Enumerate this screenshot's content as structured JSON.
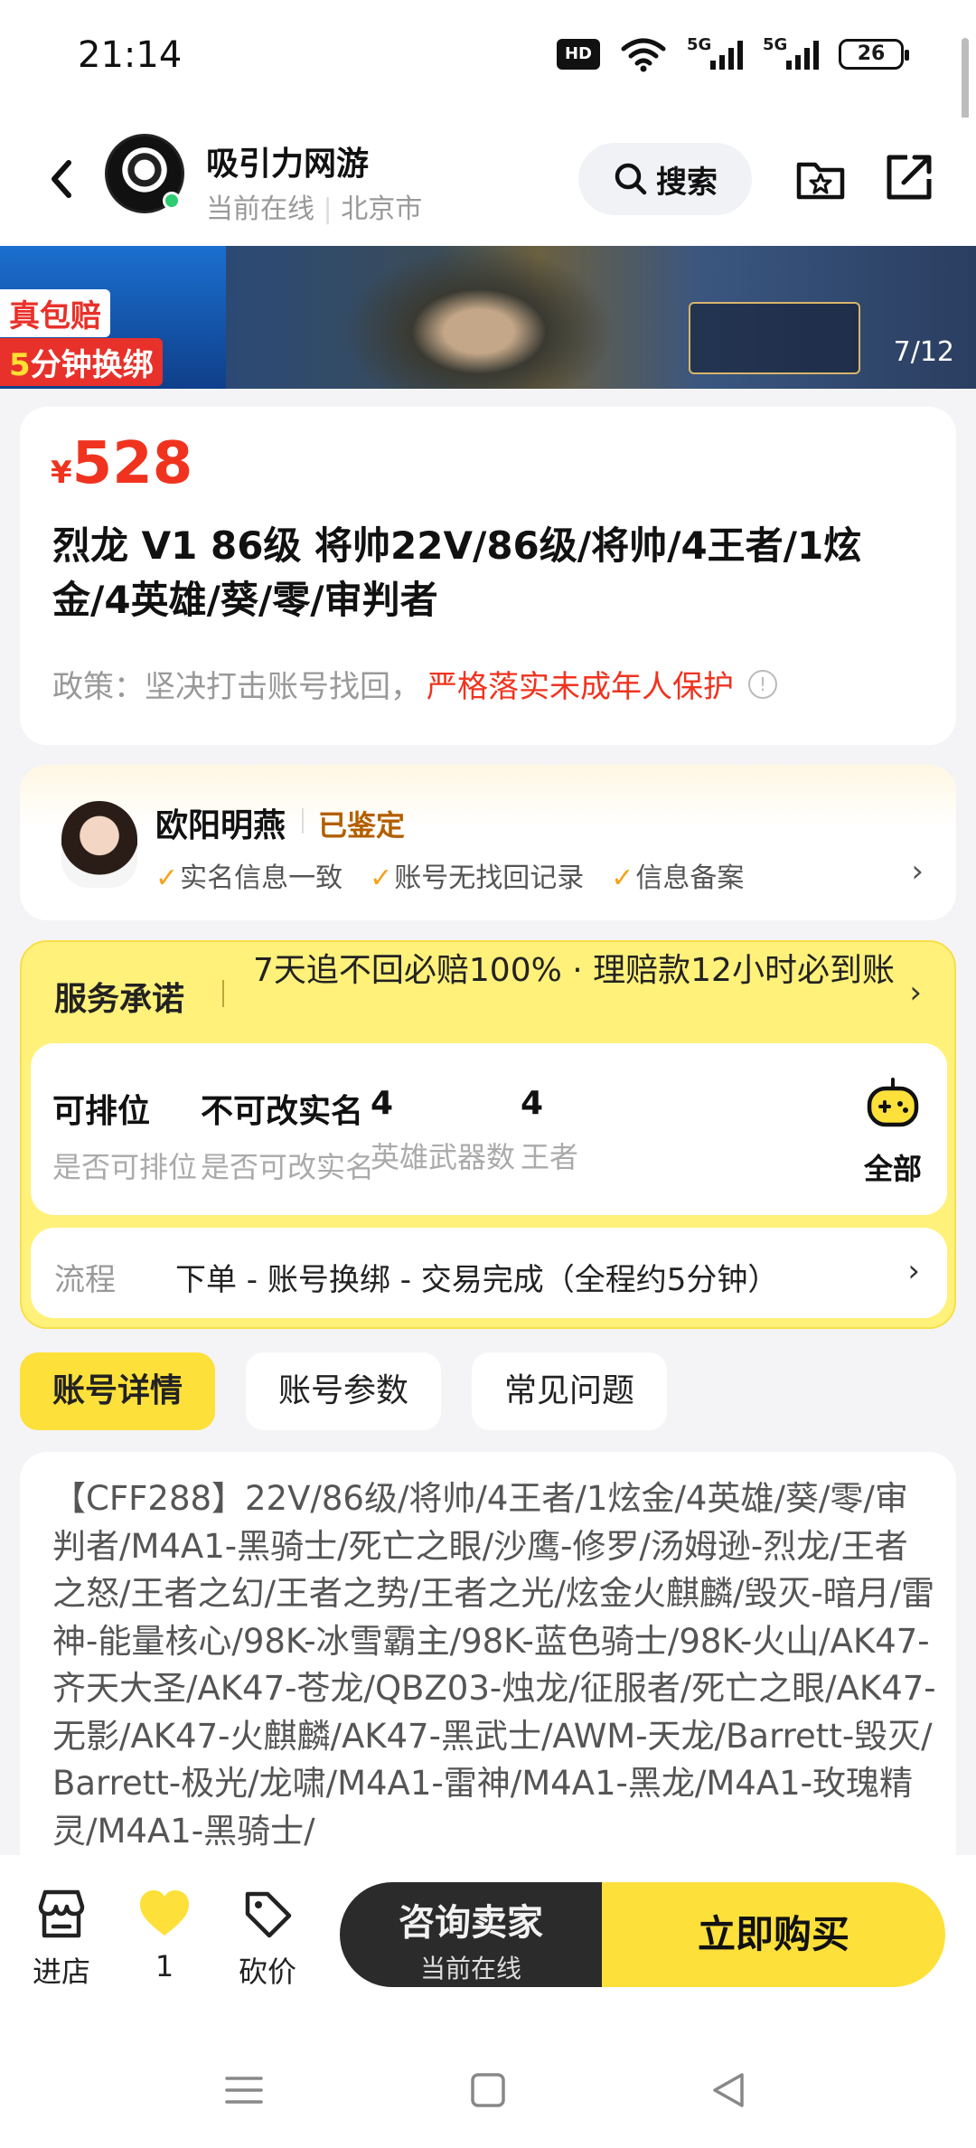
{
  "status_bar": {
    "time": "21:14",
    "hd": "HD",
    "signal1": "5G",
    "signal2": "5G",
    "battery": "26"
  },
  "header": {
    "shop_name": "吸引力网游",
    "shop_status": "当前在线",
    "shop_city": "北京市",
    "search_label": "搜索"
  },
  "banner": {
    "tag_line1": "真包赔",
    "tag_line2_prefix": "5",
    "tag_line2_rest": "分钟换绑",
    "counter": "7/12"
  },
  "product": {
    "currency": "¥",
    "price": "528",
    "title": "烈龙 V1 86级 将帅22V/86级/将帅/4王者/1炫金/4英雄/葵/零/审判者",
    "policy_prefix": "政策：坚决打击账号找回，",
    "policy_highlight": "严格落实未成年人保护",
    "policy_icon": "info-icon"
  },
  "appraiser": {
    "name": "欧阳明燕",
    "status": "已鉴定",
    "checks": [
      "实名信息一致",
      "账号无找回记录",
      "信息备案"
    ]
  },
  "service": {
    "label": "服务承诺",
    "text": "7天追不回必赔100% · 理赔款12小时必到账",
    "attributes": [
      {
        "value": "可排位",
        "key": "是否可排位"
      },
      {
        "value": "不可改实名",
        "key": "是否可改实名"
      },
      {
        "value": "4",
        "key": "英雄武器数"
      },
      {
        "value": "4",
        "key": "王者"
      }
    ],
    "all_label": "全部",
    "flow_label": "流程",
    "flow_text": "下单 - 账号换绑 - 交易完成（全程约5分钟）"
  },
  "tabs": [
    "账号详情",
    "账号参数",
    "常见问题"
  ],
  "details": {
    "text": "【CFF288】22V/86级/将帅/4王者/1炫金/4英雄/葵/零/审判者/M4A1-黑骑士/死亡之眼/沙鹰-修罗/汤姆逊-烈龙/王者之怒/王者之幻/王者之势/王者之光/炫金火麒麟/毁灭-暗月/雷神-能量核心/98K-冰雪霸主/98K-蓝色骑士/98K-火山/AK47-齐天大圣/AK47-苍龙/QBZ03-烛龙/征服者/死亡之眼/AK47-无影/AK47-火麒麟/AK47-黑武士/AWM-天龙/Barrett-毁灭/Barrett-极光/龙啸/M4A1-雷神/M4A1-黑龙/M4A1-玫瑰精灵/M4A1-黑骑士/"
  },
  "bottom_bar": {
    "store_label": "进店",
    "like_count": "1",
    "bargain_label": "砍价",
    "consult_label": "咨询卖家",
    "consult_sub": "当前在线",
    "buy_label": "立即购买"
  },
  "colors": {
    "accent_yellow": "#fde03a",
    "price_red": "#f0331f",
    "verified_brown": "#b35f00",
    "check_orange": "#f7a11a"
  }
}
